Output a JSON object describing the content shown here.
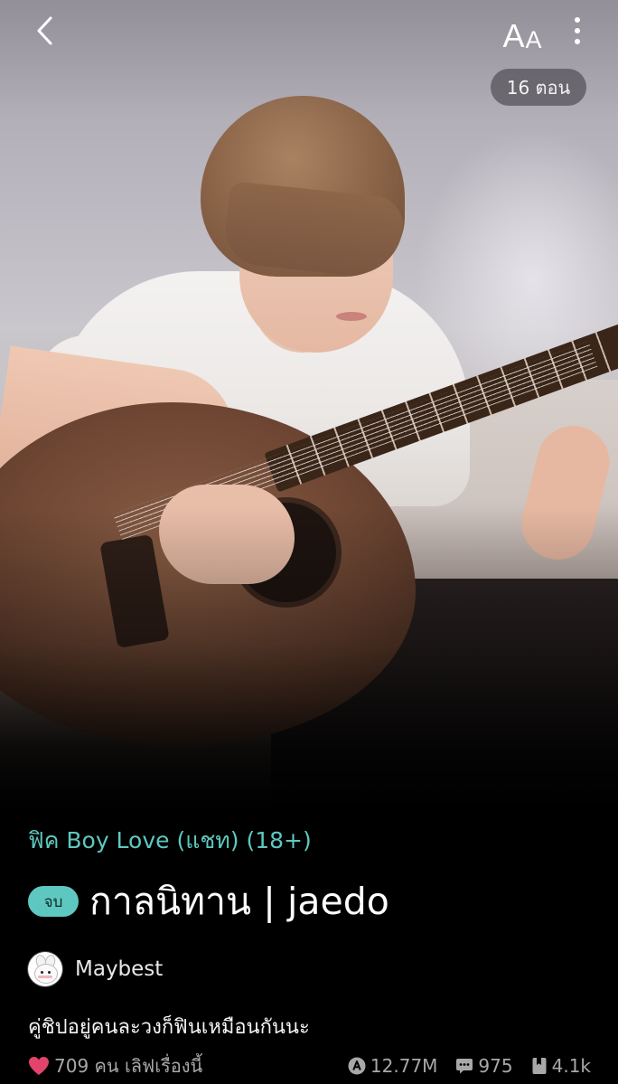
{
  "topbar": {
    "back_icon": "chevron-left-icon",
    "font_size_label_big": "A",
    "font_size_label_small": "A",
    "more_icon": "more-vertical-icon",
    "episode_count": "16 ตอน"
  },
  "story": {
    "genre": "ฟิค Boy Love (แชท) (18+)",
    "status_badge": "จบ",
    "title": "กาลนิทาน | jaedo",
    "author": "Maybest",
    "tagline": "คู่ชิปอยู่คนละวงก็ฟินเหมือนกันนะ"
  },
  "stats": {
    "love_text": "709 คน เลิฟเรื่องนี้",
    "reads": "12.77M",
    "comments": "975",
    "bookmarks": "4.1k"
  },
  "colors": {
    "accent": "#5ec8c0",
    "heart": "#e2446a",
    "background": "#000000"
  }
}
